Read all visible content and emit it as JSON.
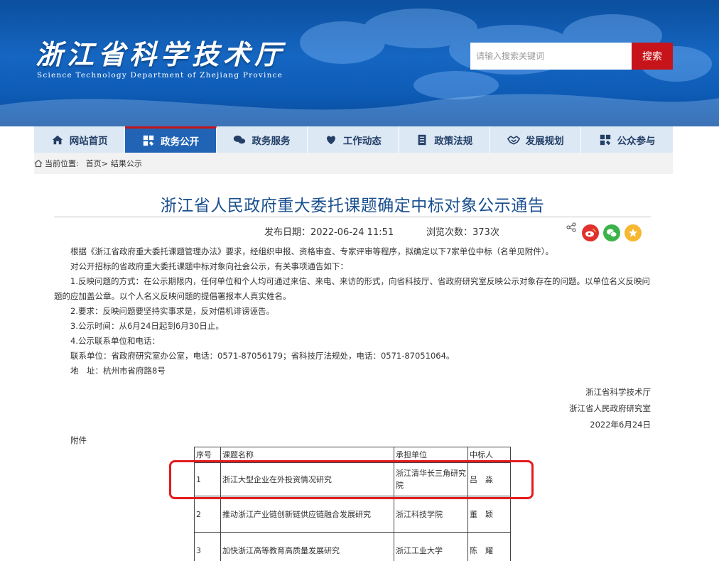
{
  "header": {
    "site_title": "浙江省科学技术厅",
    "site_subtitle": "Science Technology Department of Zhejiang Province",
    "search_placeholder": "请输入搜索关键词",
    "search_button": "搜索"
  },
  "nav": {
    "items": [
      {
        "label": "网站首页",
        "icon": "home-icon"
      },
      {
        "label": "政务公开",
        "icon": "shield-icon",
        "active": true
      },
      {
        "label": "政务服务",
        "icon": "chat-icon"
      },
      {
        "label": "工作动态",
        "icon": "heart-icon"
      },
      {
        "label": "政策法规",
        "icon": "document-icon"
      },
      {
        "label": "发展规划",
        "icon": "handshake-icon"
      },
      {
        "label": "公众参与",
        "icon": "people-icon"
      }
    ]
  },
  "breadcrumb": {
    "label": "当前位置:",
    "home": "首页>",
    "current": "结果公示"
  },
  "article": {
    "title": "浙江省人民政府重大委托课题确定中标对象公示通告",
    "publish_date": "发布日期：2022-06-24 11:51",
    "views": "浏览次数：373次",
    "paragraphs": [
      "根据《浙江省政府重大委托课题管理办法》要求，经组织申报、资格审查、专家评审等程序，拟确定以下7家单位中标（名单见附件）。",
      "对公开招标的省政府重大委托课题中标对象向社会公示，有关事项通告如下：",
      "1.反映问题的方式：在公示期限内，任何单位和个人均可通过来信、来电、来访的形式，向省科技厅、省政府研究室反映公示对象存在的问题。以单位名义反映问题的应加盖公章。以个人名义反映问题的提倡署报本人真实姓名。",
      "2.要求：反映问题要坚持实事求是，反对借机诽谤诬告。",
      "3.公示时间：从6月24日起到6月30日止。",
      "4.公示联系单位和电话：",
      "联系单位：省政府研究室办公室，电话：0571-87056179；省科技厅法规处，电话：0571-87051064。",
      "地　址：杭州市省府路8号"
    ],
    "signatures": [
      "浙江省科学技术厅",
      "浙江省人民政府研究室",
      "2022年6月24日"
    ],
    "attachment_label": "附件"
  },
  "table": {
    "headers": [
      "序号",
      "课题名称",
      "承担单位",
      "中标人"
    ],
    "rows": [
      [
        "1",
        "浙江大型企业在外投资情况研究",
        "浙江清华长三角研究院",
        "吕　淼"
      ],
      [
        "2",
        "推动浙江产业链创新链供应链融合发展研究",
        "浙江科技学院",
        "董　颖"
      ],
      [
        "3",
        "加快浙江高等教育高质量发展研究",
        "浙江工业大学",
        "陈　耀"
      ]
    ]
  },
  "colors": {
    "banner": "#1566c2",
    "nav_active": "#2164b5",
    "accent_red": "#c7141a",
    "title_blue": "#1a4f8f",
    "highlight_red": "#e41c1c"
  }
}
